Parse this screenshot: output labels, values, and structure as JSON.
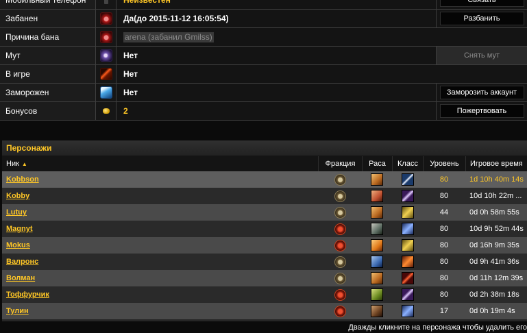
{
  "account": {
    "rows": [
      {
        "label": "Мобильный телефон",
        "value": "Неизвестен",
        "action": "Связать"
      },
      {
        "label": "Забанен",
        "value": "Да(до 2015-11-12 16:05:54)",
        "action": "Разбанить"
      },
      {
        "label": "Причина бана",
        "value": "arena (забанил Gmilss)"
      },
      {
        "label": "Мут",
        "value": "Нет",
        "action": "Снять мут"
      },
      {
        "label": "В игре",
        "value": "Нет"
      },
      {
        "label": "Заморожен",
        "value": "Нет",
        "action": "Заморозить аккаунт"
      },
      {
        "label": "Бонусов",
        "value": "2",
        "action": "Пожертвовать"
      }
    ]
  },
  "characters": {
    "title": "Персонажи",
    "headers": {
      "name": "Ник",
      "faction": "Фракция",
      "race": "Раса",
      "class": "Класс",
      "level": "Уровень",
      "playtime": "Игровое время"
    },
    "rows": [
      {
        "name": "Kobbson",
        "faction": "alliance",
        "race": "human",
        "class": "warrior",
        "level": "80",
        "playtime": "1d 10h 40m 14s"
      },
      {
        "name": "Kobby",
        "faction": "alliance",
        "race": "gnome",
        "class": "priest",
        "level": "80",
        "playtime": "10d 10h 22m ..."
      },
      {
        "name": "Lutuy",
        "faction": "alliance",
        "race": "human",
        "class": "paladin",
        "level": "44",
        "playtime": "0d 0h 58m 55s"
      },
      {
        "name": "Magnyt",
        "faction": "horde",
        "race": "undead",
        "class": "shaman",
        "level": "80",
        "playtime": "10d 9h 52m 44s"
      },
      {
        "name": "Mokus",
        "faction": "horde",
        "race": "bloodelf",
        "class": "paladin",
        "level": "80",
        "playtime": "0d 16h 9m 35s"
      },
      {
        "name": "Валронс",
        "faction": "alliance",
        "race": "draenei",
        "class": "hunter",
        "level": "80",
        "playtime": "0d 9h 41m 36s"
      },
      {
        "name": "Волман",
        "faction": "alliance",
        "race": "human",
        "class": "rogue",
        "level": "80",
        "playtime": "0d 11h 12m 39s"
      },
      {
        "name": "Тоффурчик",
        "faction": "horde",
        "race": "goblin",
        "class": "priest",
        "level": "80",
        "playtime": "0d 2h 38m 18s"
      },
      {
        "name": "Тулин",
        "faction": "horde",
        "race": "tauren",
        "class": "shaman",
        "level": "17",
        "playtime": "0d 0h 19m 4s"
      }
    ],
    "footer_note": "Дважды кликните на персонажа чтобы удалить его"
  },
  "colors": {
    "accent": "#ffc726",
    "background": "#0b0b0b"
  }
}
